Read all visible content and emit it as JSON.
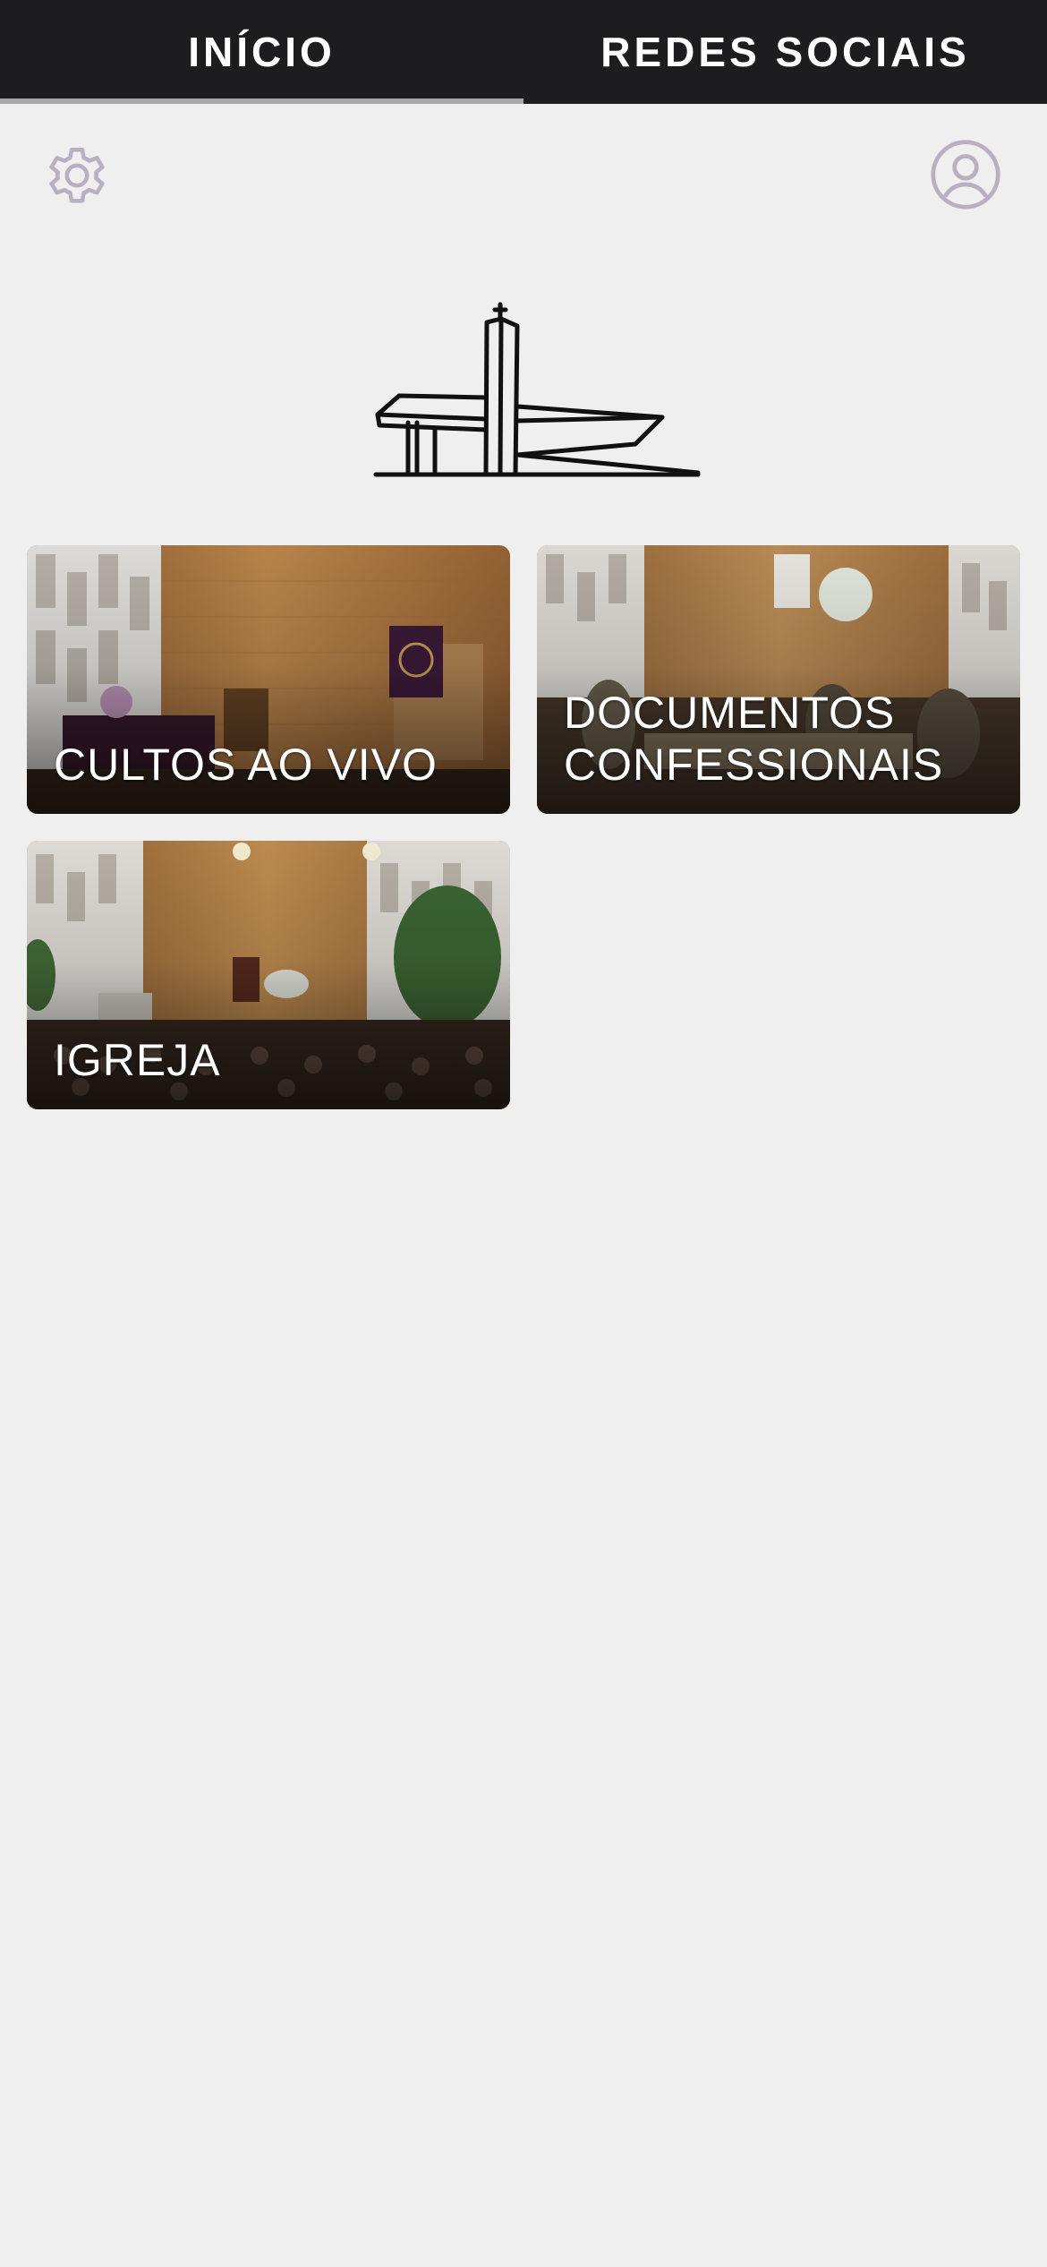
{
  "tabs": [
    {
      "label": "INÍCIO",
      "active": true
    },
    {
      "label": "REDES SOCIAIS",
      "active": false
    }
  ],
  "header": {
    "settings_icon": "gear-icon",
    "profile_icon": "user-circle-icon"
  },
  "logo": {
    "icon": "church-building-logo"
  },
  "cards": [
    {
      "label": "CULTOS AO VIVO"
    },
    {
      "label": "DOCUMENTOS CONFESSIONAIS"
    },
    {
      "label": "IGREJA"
    }
  ],
  "colors": {
    "tabbar_bg": "#1d1d1f",
    "tab_indicator": "#a8a8a8",
    "page_bg": "#efefef",
    "icon_color": "#b9afc2"
  }
}
